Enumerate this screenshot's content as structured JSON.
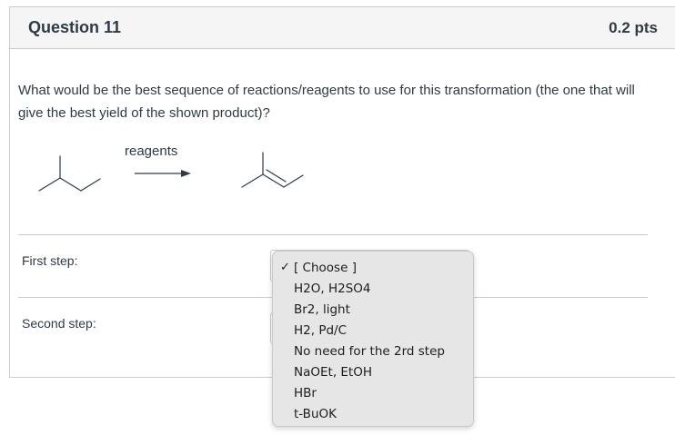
{
  "question": {
    "title": "Question 11",
    "points": "0.2 pts",
    "prompt": "What would be the best sequence of reactions/reagents to use for this transformation (the one that will give the best yield of the shown product)?",
    "scheme": {
      "arrow_label": "reagents",
      "starting_material": "isobutane skeletal structure",
      "product": "2-methyl-2-butene skeletal structure"
    }
  },
  "steps": [
    {
      "label": "First step:",
      "selected": "[ Choose ]"
    },
    {
      "label": "Second step:",
      "selected": "[ Choose ]"
    }
  ],
  "dropdown": {
    "selected_mark": "✓",
    "options": [
      "[ Choose ]",
      "H2O, H2SO4",
      "Br2, light",
      "H2, Pd/C",
      "No need for the 2rd step",
      "NaOEt, EtOH",
      "HBr",
      "t-BuOK"
    ]
  }
}
